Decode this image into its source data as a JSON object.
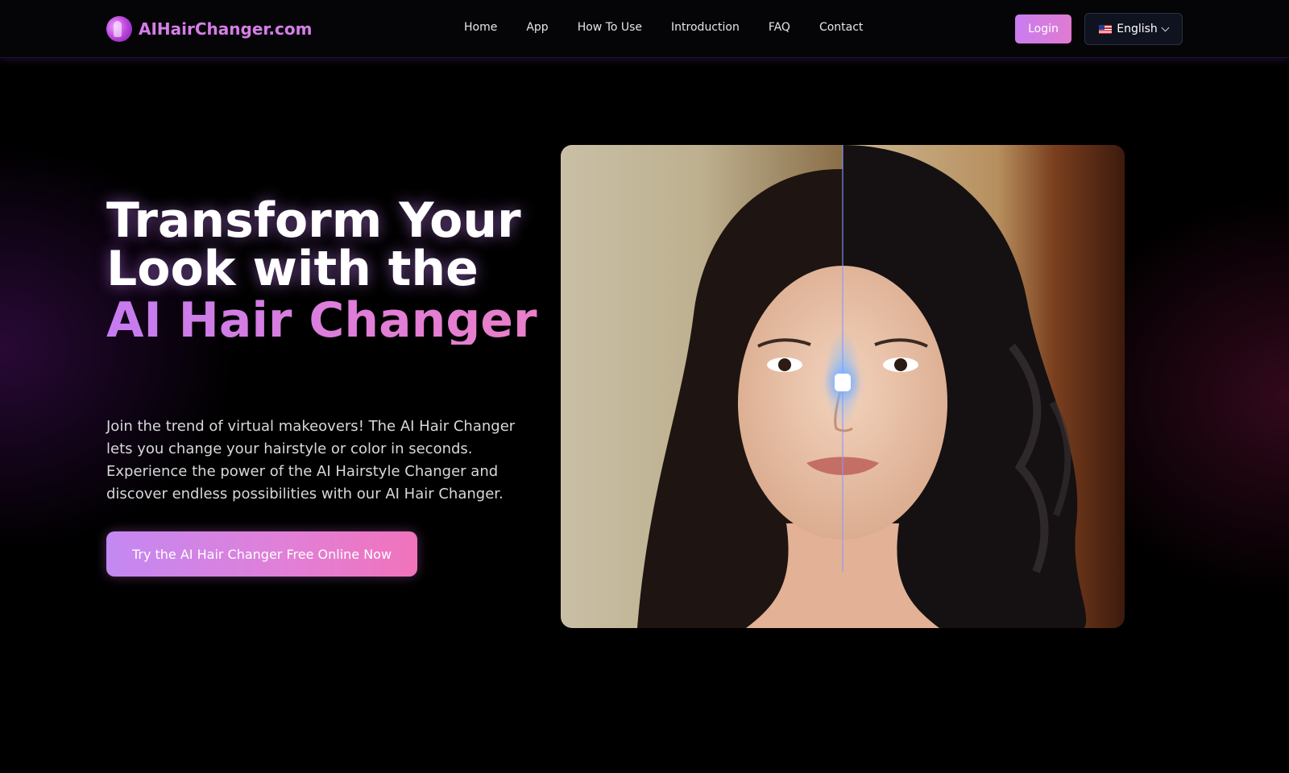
{
  "header": {
    "brand_name": "AIHairChanger.com",
    "nav": [
      "Home",
      "App",
      "How To Use",
      "Introduction",
      "FAQ",
      "Contact"
    ],
    "login_label": "Login",
    "language_label": "English"
  },
  "hero": {
    "headline_white_1": "Transform Your",
    "headline_white_2": "Look with the",
    "headline_accent": "AI Hair Changer",
    "description": "Join the trend of virtual makeovers! The AI Hair Changer lets you change your hairstyle or color in seconds. Experience the power of the AI Hairstyle Changer and discover endless possibilities with our AI Hair Changer.",
    "cta_label": "Try the AI Hair Changer Free Online Now"
  },
  "comparison": {
    "slider_position_fraction": 0.5
  },
  "colors": {
    "accent_purple": "#c47cf0",
    "accent_pink": "#e87fc8",
    "background": "#000000"
  },
  "icons": {
    "logo": "brand-logo-icon",
    "language_flag": "us-flag-icon",
    "language_chevron": "chevron-down-icon"
  }
}
